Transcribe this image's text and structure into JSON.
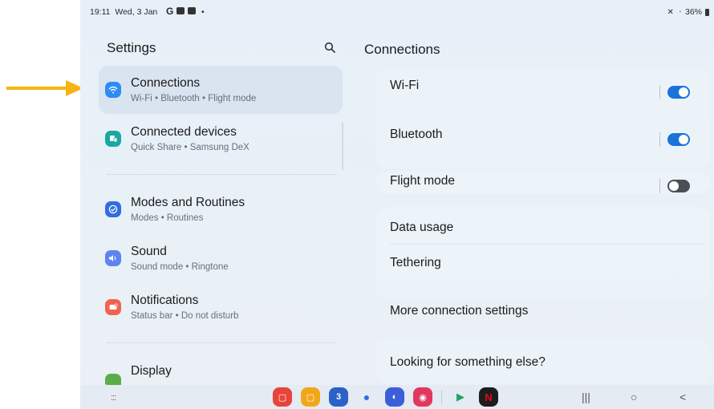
{
  "status_bar": {
    "time": "19:11",
    "date": "Wed, 3 Jan",
    "g_logo": "G",
    "dot": "•",
    "battery": "36%"
  },
  "left_panel": {
    "title": "Settings",
    "items": [
      {
        "title": "Connections",
        "subtitle": "Wi-Fi • Bluetooth • Flight mode",
        "icon": "wifi-icon",
        "color": "#2e8cf3",
        "selected": true
      },
      {
        "title": "Connected devices",
        "subtitle": "Quick Share • Samsung DeX",
        "icon": "devices-icon",
        "color": "#1aa7a2",
        "selected": false
      },
      {
        "title": "Modes and Routines",
        "subtitle": "Modes • Routines",
        "icon": "check-circle-icon",
        "color": "#2f6fe2",
        "selected": false
      },
      {
        "title": "Sound",
        "subtitle": "Sound mode • Ringtone",
        "icon": "speaker-icon",
        "color": "#5e84f0",
        "selected": false
      },
      {
        "title": "Notifications",
        "subtitle": "Status bar • Do not disturb",
        "icon": "bell-icon",
        "color": "#f1624f",
        "selected": false
      },
      {
        "title": "Display",
        "subtitle": "",
        "icon": "display-icon",
        "color": "#5cad4a",
        "selected": false
      }
    ]
  },
  "right_panel": {
    "title": "Connections",
    "rows": [
      {
        "label": "Wi-Fi",
        "toggle": "on"
      },
      {
        "label": "Bluetooth",
        "toggle": "on"
      },
      {
        "label": "Flight mode",
        "toggle": "off"
      },
      {
        "label": "Data usage"
      },
      {
        "label": "Tethering"
      },
      {
        "label": "More connection settings"
      },
      {
        "label": "Looking for something else?"
      }
    ]
  },
  "nav_bar": {
    "apps_icon": ":::",
    "dock_apps": [
      {
        "name": "samsung-notes-icon",
        "color": "#e8443a",
        "glyph": "▢"
      },
      {
        "name": "my-files-icon",
        "color": "#f2a71b",
        "glyph": "▢"
      },
      {
        "name": "calendar-icon",
        "color": "#2b62c9",
        "glyph": "3"
      },
      {
        "name": "messages-icon",
        "color": "#2f6fe2",
        "glyph": "●"
      },
      {
        "name": "internet-icon",
        "color": "#3b5fd6",
        "glyph": "◐"
      },
      {
        "name": "camera-icon",
        "color": "#e2375f",
        "glyph": "◉"
      },
      {
        "name": "play-store-icon",
        "color": "#e9eef3",
        "glyph": "▶"
      },
      {
        "name": "netflix-icon",
        "color": "#1d1d1d",
        "glyph": "N"
      }
    ],
    "recents": "|||",
    "home": "○",
    "back": "<"
  },
  "colors": {
    "accent": "#1a73d9",
    "arrow": "#f5b512"
  }
}
